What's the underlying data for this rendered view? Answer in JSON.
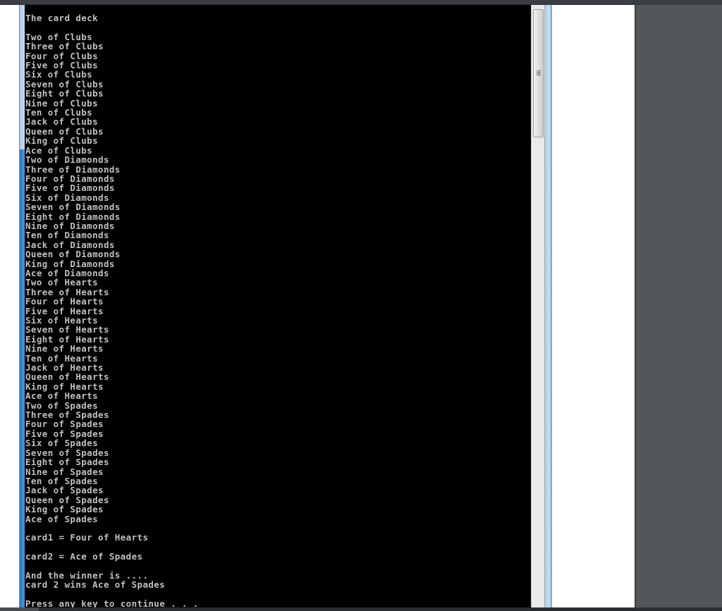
{
  "console": {
    "title_line": "The card deck",
    "deck": [
      "Two of Clubs",
      "Three of Clubs",
      "Four of Clubs",
      "Five of Clubs",
      "Six of Clubs",
      "Seven of Clubs",
      "Eight of Clubs",
      "Nine of Clubs",
      "Ten of Clubs",
      "Jack of Clubs",
      "Queen of Clubs",
      "King of Clubs",
      "Ace of Clubs",
      "Two of Diamonds",
      "Three of Diamonds",
      "Four of Diamonds",
      "Five of Diamonds",
      "Six of Diamonds",
      "Seven of Diamonds",
      "Eight of Diamonds",
      "Nine of Diamonds",
      "Ten of Diamonds",
      "Jack of Diamonds",
      "Queen of Diamonds",
      "King of Diamonds",
      "Ace of Diamonds",
      "Two of Hearts",
      "Three of Hearts",
      "Four of Hearts",
      "Five of Hearts",
      "Six of Hearts",
      "Seven of Hearts",
      "Eight of Hearts",
      "Nine of Hearts",
      "Ten of Hearts",
      "Jack of Hearts",
      "Queen of Hearts",
      "King of Hearts",
      "Ace of Hearts",
      "Two of Spades",
      "Three of Spades",
      "Four of Spades",
      "Five of Spades",
      "Six of Spades",
      "Seven of Spades",
      "Eight of Spades",
      "Nine of Spades",
      "Ten of Spades",
      "Jack of Spades",
      "Queen of Spades",
      "King of Spades",
      "Ace of Spades"
    ],
    "card1_line": "card1 = Four of Hearts",
    "card2_line": "card2 = Ace of Spades",
    "winner_intro": "And the winner is ....",
    "winner_line": "card 2 wins Ace of Spades",
    "prompt": "Press any key to continue . . ."
  },
  "colors": {
    "console_bg": "#000000",
    "console_text": "#c0c0c0",
    "desktop_bg": "#53575a",
    "frame_accent": "#4e97d6"
  },
  "icons": {
    "scrollbar_grip": "grip-lines-icon"
  }
}
